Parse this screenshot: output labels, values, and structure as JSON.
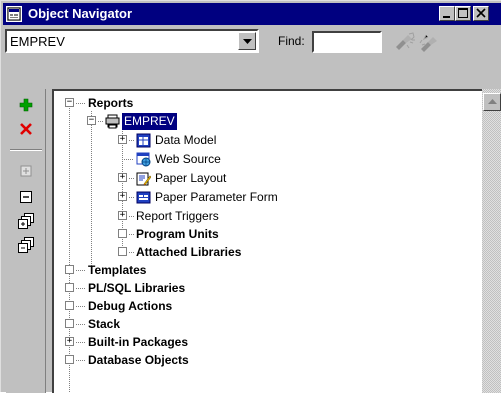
{
  "window": {
    "title": "Object Navigator"
  },
  "toolbar": {
    "module_combo_value": "EMPREV",
    "find_label": "Find:",
    "find_value": ""
  },
  "icons": {
    "create": "plus-icon",
    "delete": "delete-x-icon",
    "expand": "expand-icon",
    "collapse": "collapse-icon",
    "expand_all": "expand-all-icon",
    "collapse_all": "collapse-all-icon",
    "search_forward": "flashlight-forward-icon",
    "search_backward": "flashlight-backward-icon"
  },
  "colors": {
    "titlebar": "#000080",
    "selection": "#000080",
    "create_icon": "#00a000",
    "delete_icon": "#e00000"
  },
  "tree": [
    {
      "label": "Reports",
      "bold": true,
      "expander": "−"
    },
    {
      "label": "EMPREV",
      "bold": false,
      "expander": "−",
      "selected": true,
      "icon": "report-icon"
    },
    {
      "label": "Data Model",
      "bold": false,
      "expander": "+",
      "icon": "data-model-icon"
    },
    {
      "label": "Web Source",
      "bold": false,
      "expander": "",
      "icon": "web-source-icon"
    },
    {
      "label": "Paper Layout",
      "bold": false,
      "expander": "+",
      "icon": "paper-layout-icon"
    },
    {
      "label": "Paper Parameter Form",
      "bold": false,
      "expander": "+",
      "icon": "parameter-form-icon"
    },
    {
      "label": "Report Triggers",
      "bold": false,
      "expander": "+"
    },
    {
      "label": "Program Units",
      "bold": true,
      "expander": ""
    },
    {
      "label": "Attached Libraries",
      "bold": true,
      "expander": ""
    },
    {
      "label": "Templates",
      "bold": true,
      "expander": ""
    },
    {
      "label": "PL/SQL Libraries",
      "bold": true,
      "expander": ""
    },
    {
      "label": "Debug Actions",
      "bold": true,
      "expander": ""
    },
    {
      "label": "Stack",
      "bold": true,
      "expander": ""
    },
    {
      "label": "Built-in Packages",
      "bold": true,
      "expander": "+"
    },
    {
      "label": "Database Objects",
      "bold": true,
      "expander": ""
    }
  ]
}
